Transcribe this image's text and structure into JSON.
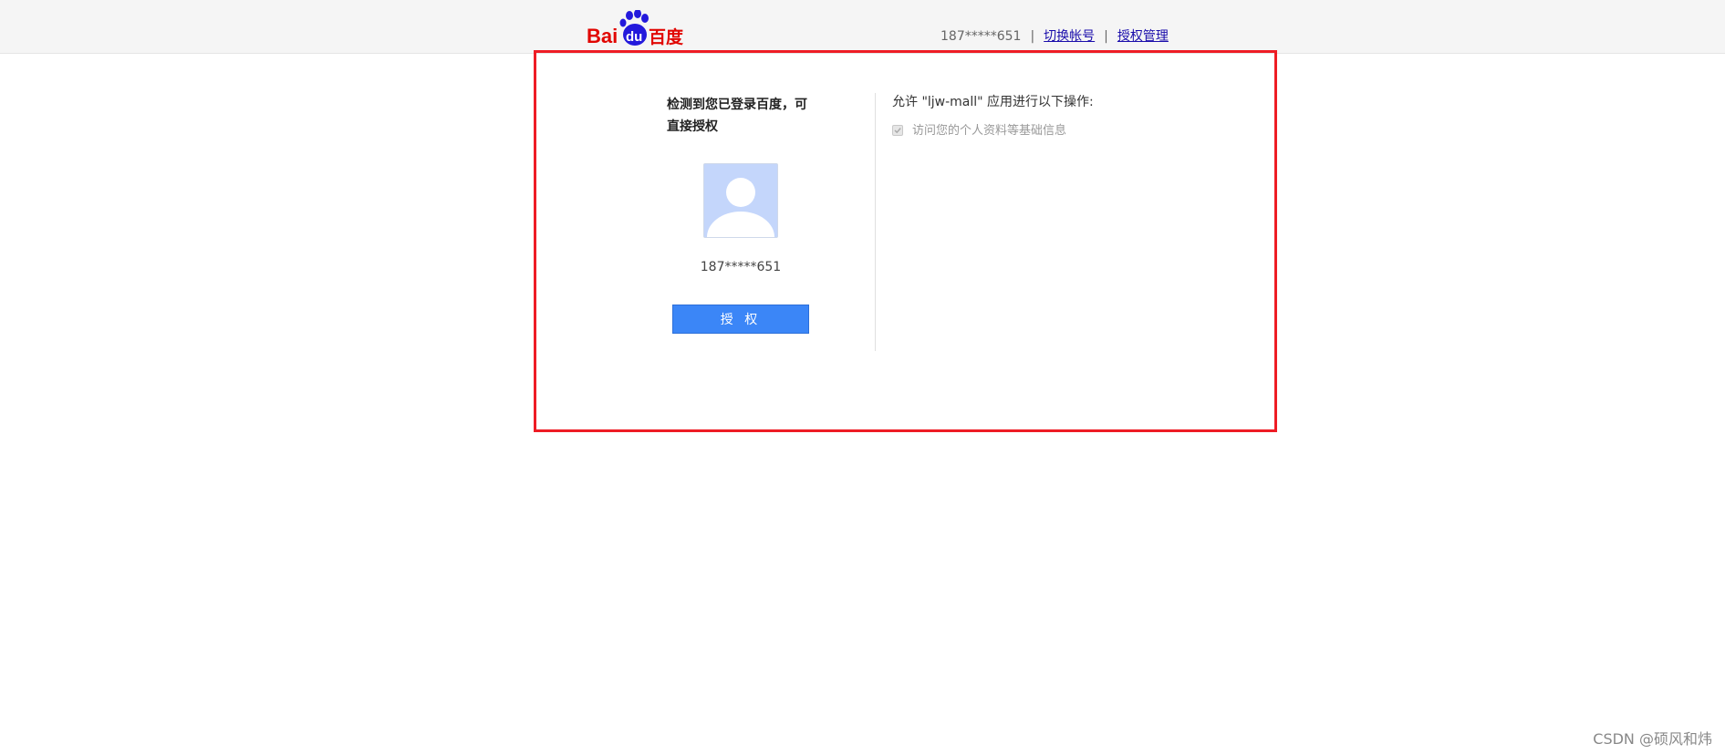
{
  "header": {
    "logo_text_latin": "Bai",
    "logo_text_du": "du",
    "logo_text_cn": "百度",
    "account": "187*****651",
    "separator": "|",
    "switch_account": "切换帐号",
    "auth_manage": "授权管理"
  },
  "login_panel": {
    "detect_text": "检测到您已登录百度，可直接授权",
    "account_name": "187*****651",
    "authorize_button": "授 权"
  },
  "permissions": {
    "title": "允许 \"ljw-mall\" 应用进行以下操作:",
    "items": [
      {
        "label": "访问您的个人资料等基础信息",
        "checked": true,
        "disabled": true
      }
    ]
  },
  "watermark": "CSDN @硕风和炜",
  "colors": {
    "frame": "#ee1c25",
    "button": "#3b86f7",
    "logo_red": "#e10602",
    "logo_blue": "#2319dc",
    "avatar_bg": "#c4d6fb"
  }
}
